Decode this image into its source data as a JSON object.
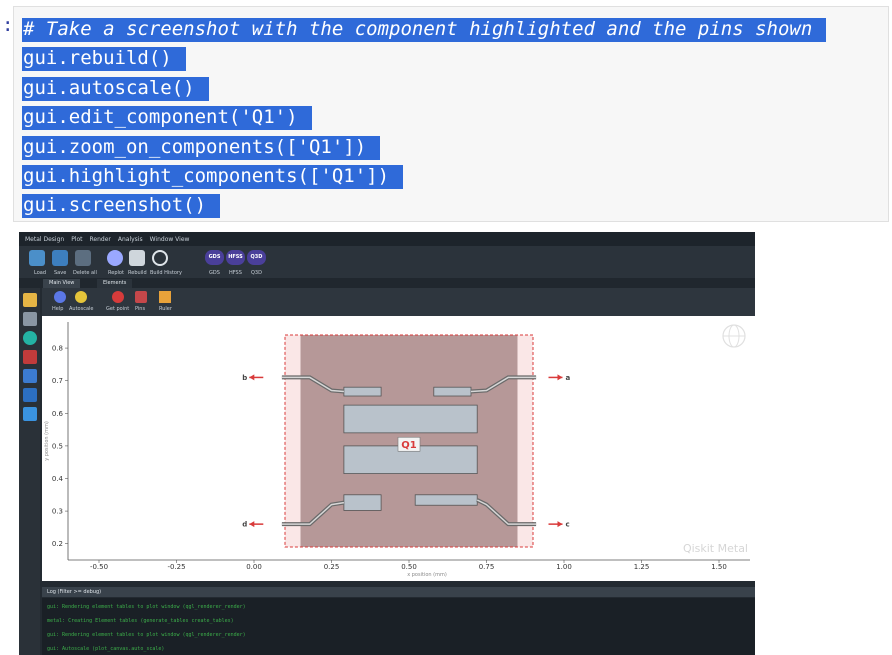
{
  "cell": {
    "prompt": ":",
    "lines": [
      "# Take a screenshot with the component highlighted and the pins shown",
      "gui.rebuild()",
      "gui.autoscale()",
      "gui.edit_component('Q1')",
      "gui.zoom_on_components(['Q1'])",
      "gui.highlight_components(['Q1'])",
      "gui.screenshot()"
    ]
  },
  "app": {
    "menu": [
      "Metal Design",
      "Plot",
      "Render",
      "Analysis",
      "Window View"
    ],
    "ribbon": {
      "load": "Load",
      "save": "Save",
      "delete_all": "Delete all",
      "replot": "Replot",
      "rebuild": "Rebuild",
      "build_history": "Build History",
      "gds": "GDS",
      "hfss": "HFSS",
      "q3d": "Q3D"
    },
    "tabs": {
      "main_view": "Main View",
      "elements": "Elements"
    },
    "toolbar": {
      "help": "Help",
      "autoscale": "Autoscale",
      "get_point": "Get point",
      "pins": "Pins",
      "ruler": "Ruler"
    },
    "log": {
      "title": "Log (Filter >= debug)",
      "lines": [
        "gui: Rendering element tables to plot window (qgl_renderer_render)",
        "metal: Creating Element tables (generate_tables create_tables)",
        "gui: Rendering element tables to plot window (qgl_renderer_render)",
        "gui: Autoscale (plot_canvas.auto_scale)"
      ]
    }
  },
  "chart_data": {
    "type": "scatter",
    "xlabel": "x position (mm)",
    "ylabel": "y position (mm)",
    "xlim": [
      -0.6,
      1.6
    ],
    "ylim": [
      0.15,
      0.88
    ],
    "x_ticks": [
      "-0.50",
      "-0.25",
      "0.00",
      "0.25",
      "0.50",
      "0.75",
      "1.00",
      "1.25",
      "1.50"
    ],
    "x_tick_values": [
      -0.5,
      -0.25,
      0.0,
      0.25,
      0.5,
      0.75,
      1.0,
      1.25,
      1.5
    ],
    "y_ticks": [
      "0.2",
      "0.3",
      "0.4",
      "0.5",
      "0.6",
      "0.7",
      "0.8"
    ],
    "y_tick_values": [
      0.2,
      0.3,
      0.4,
      0.5,
      0.6,
      0.7,
      0.8
    ],
    "component_label": "Q1",
    "pins": [
      {
        "name": "a",
        "x": 0.95,
        "y": 0.71
      },
      {
        "name": "b",
        "x": 0.03,
        "y": 0.71
      },
      {
        "name": "c",
        "x": 0.95,
        "y": 0.26
      },
      {
        "name": "d",
        "x": 0.03,
        "y": 0.26
      }
    ],
    "watermark": "Qiskit Metal",
    "colors": {
      "highlight": "#d93a3a",
      "pad": "#b9c2cb",
      "ground": "#b2a5a5",
      "pin": "#d93a3a"
    }
  }
}
